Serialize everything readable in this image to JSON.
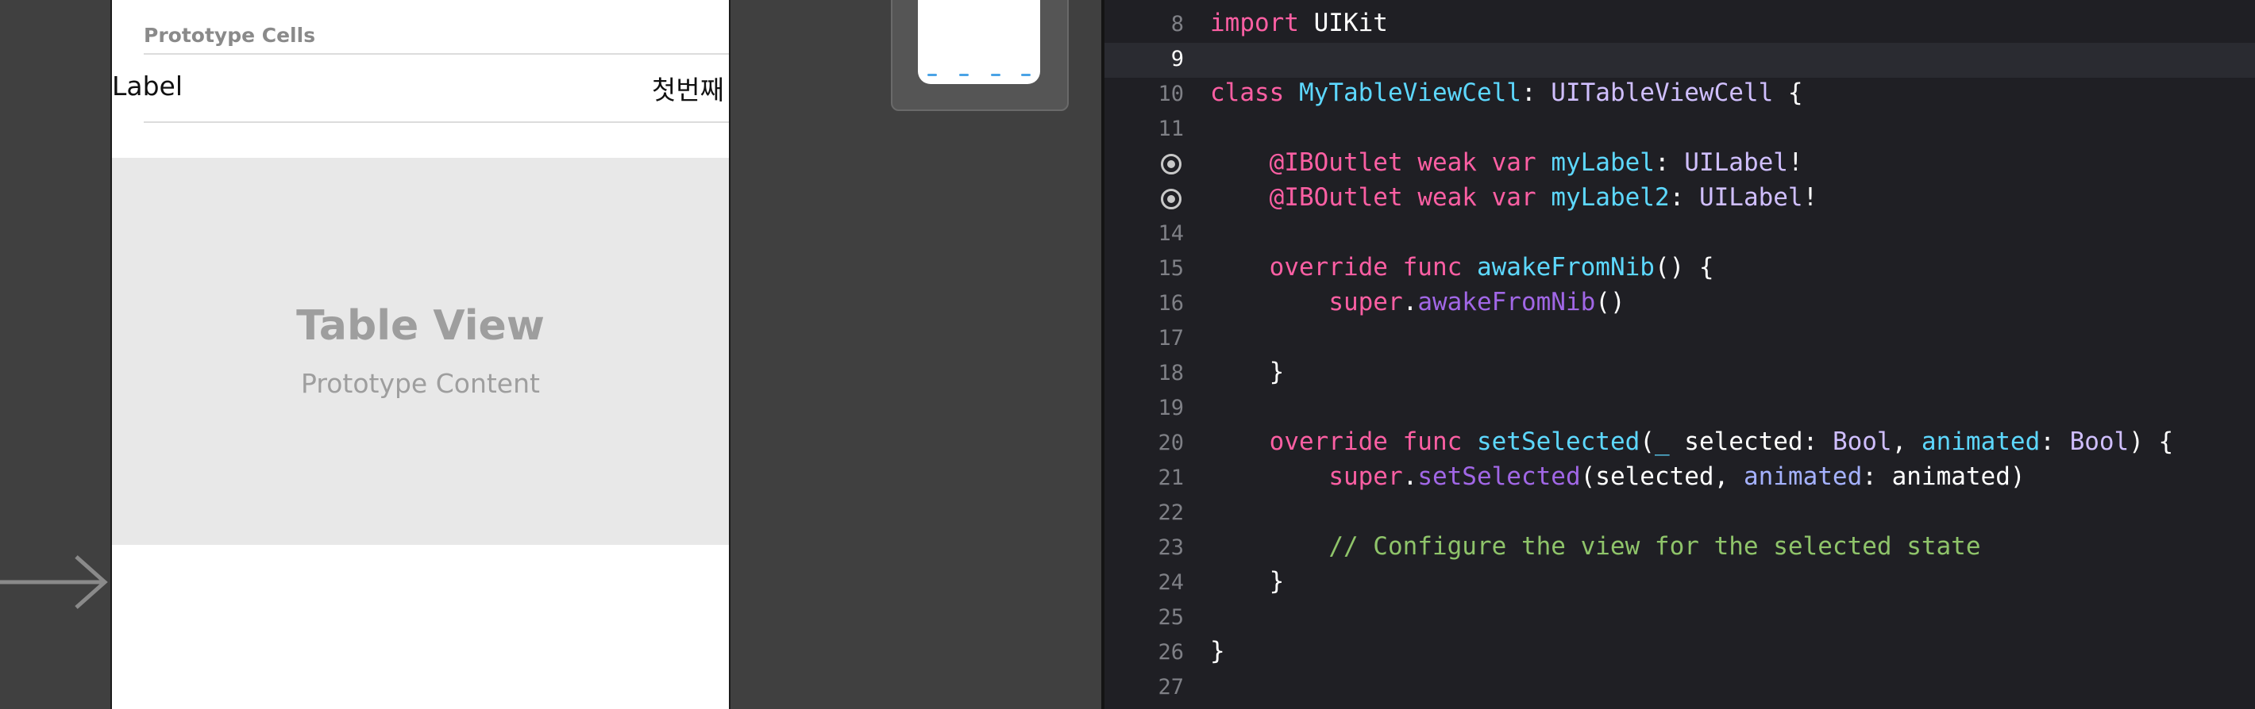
{
  "storyboard": {
    "section_header": "Prototype Cells",
    "cell_label": "Label",
    "cell_detail": "첫번째",
    "placeholder_title": "Table View",
    "placeholder_subtitle": "Prototype Content",
    "entry_arrow_icon": "arrow-right-icon"
  },
  "editor": {
    "current_line": 9,
    "lines": [
      {
        "num": "8",
        "tokens": [
          [
            "kw",
            "import"
          ],
          [
            "plain",
            " UIKit"
          ]
        ]
      },
      {
        "num": "9",
        "tokens": []
      },
      {
        "num": "10",
        "tokens": [
          [
            "kw",
            "class"
          ],
          [
            "plain",
            " "
          ],
          [
            "decl",
            "MyTableViewCell"
          ],
          [
            "plain",
            ": "
          ],
          [
            "ty",
            "UITableViewCell"
          ],
          [
            "plain",
            " {"
          ]
        ]
      },
      {
        "num": "11",
        "tokens": []
      },
      {
        "num": "",
        "outlet": true,
        "tokens": [
          [
            "plain",
            "    "
          ],
          [
            "kw",
            "@IBOutlet"
          ],
          [
            "plain",
            " "
          ],
          [
            "kw",
            "weak"
          ],
          [
            "plain",
            " "
          ],
          [
            "kw",
            "var"
          ],
          [
            "plain",
            " "
          ],
          [
            "decl",
            "myLabel"
          ],
          [
            "plain",
            ": "
          ],
          [
            "ty",
            "UILabel"
          ],
          [
            "plain",
            "!"
          ]
        ]
      },
      {
        "num": "",
        "outlet": true,
        "tokens": [
          [
            "plain",
            "    "
          ],
          [
            "kw",
            "@IBOutlet"
          ],
          [
            "plain",
            " "
          ],
          [
            "kw",
            "weak"
          ],
          [
            "plain",
            " "
          ],
          [
            "kw",
            "var"
          ],
          [
            "plain",
            " "
          ],
          [
            "decl",
            "myLabel2"
          ],
          [
            "plain",
            ": "
          ],
          [
            "ty",
            "UILabel"
          ],
          [
            "plain",
            "!"
          ]
        ]
      },
      {
        "num": "14",
        "tokens": []
      },
      {
        "num": "15",
        "tokens": [
          [
            "plain",
            "    "
          ],
          [
            "kw",
            "override"
          ],
          [
            "plain",
            " "
          ],
          [
            "kw",
            "func"
          ],
          [
            "plain",
            " "
          ],
          [
            "decl",
            "awakeFromNib"
          ],
          [
            "plain",
            "() {"
          ]
        ]
      },
      {
        "num": "16",
        "tokens": [
          [
            "plain",
            "        "
          ],
          [
            "kw",
            "super"
          ],
          [
            "plain",
            "."
          ],
          [
            "prop",
            "awakeFromNib"
          ],
          [
            "plain",
            "()"
          ]
        ]
      },
      {
        "num": "17",
        "tokens": []
      },
      {
        "num": "18",
        "tokens": [
          [
            "plain",
            "    }"
          ]
        ]
      },
      {
        "num": "19",
        "tokens": []
      },
      {
        "num": "20",
        "tokens": [
          [
            "plain",
            "    "
          ],
          [
            "kw",
            "override"
          ],
          [
            "plain",
            " "
          ],
          [
            "kw",
            "func"
          ],
          [
            "plain",
            " "
          ],
          [
            "decl",
            "setSelected"
          ],
          [
            "plain",
            "("
          ],
          [
            "decl",
            "_"
          ],
          [
            "plain",
            " selected: "
          ],
          [
            "ty",
            "Bool"
          ],
          [
            "plain",
            ", "
          ],
          [
            "decl",
            "animated"
          ],
          [
            "plain",
            ": "
          ],
          [
            "ty",
            "Bool"
          ],
          [
            "plain",
            ") {"
          ]
        ]
      },
      {
        "num": "21",
        "tokens": [
          [
            "plain",
            "        "
          ],
          [
            "kw",
            "super"
          ],
          [
            "plain",
            "."
          ],
          [
            "prop",
            "setSelected"
          ],
          [
            "plain",
            "(selected, "
          ],
          [
            "param",
            "animated"
          ],
          [
            "plain",
            ": animated)"
          ]
        ]
      },
      {
        "num": "22",
        "tokens": []
      },
      {
        "num": "23",
        "tokens": [
          [
            "plain",
            "        "
          ],
          [
            "cmt2",
            "// Configure the view for the selected state"
          ]
        ]
      },
      {
        "num": "24",
        "tokens": [
          [
            "plain",
            "    }"
          ]
        ]
      },
      {
        "num": "25",
        "tokens": []
      },
      {
        "num": "26",
        "tokens": [
          [
            "plain",
            "}"
          ]
        ]
      },
      {
        "num": "27",
        "tokens": []
      }
    ]
  }
}
